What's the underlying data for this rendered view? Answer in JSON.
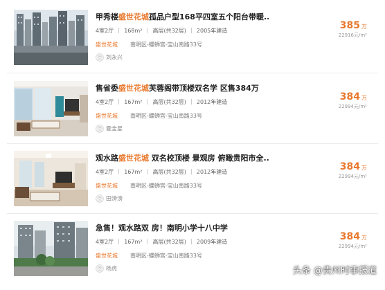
{
  "listings": [
    {
      "title_prefix": "甲秀楼",
      "title_highlight": "盛世花城",
      "title_suffix": "孤品户型168平四室五个阳台带暖...",
      "layout": "4室2厅",
      "area": "168m²",
      "floor": "高层(共32层)",
      "year": "2005年建造",
      "community": "盛世花城",
      "location": "南明区-螺蛳宫-宝山南路33号",
      "agent": "刘永兴",
      "price": "385",
      "price_unit": "万",
      "unit_price": "22916元/m²"
    },
    {
      "title_prefix": "售省委",
      "title_highlight": "盛世花城",
      "title_suffix": "芙蓉阁带顶楼双名学 区售384万",
      "layout": "4室2厅",
      "area": "167m²",
      "floor": "高层(共32层)",
      "year": "2012年建造",
      "community": "盛世花城",
      "location": "南明区-螺蛳宫-宝山南路33号",
      "agent": "霍金星",
      "price": "384",
      "price_unit": "万",
      "unit_price": "22994元/m²"
    },
    {
      "title_prefix": "观水路",
      "title_highlight": "盛世花城",
      "title_suffix": " 双名校顶楼 景观房 俯瞰贵阳市全...",
      "layout": "4室2厅",
      "area": "167m²",
      "floor": "高层(共32层)",
      "year": "2012年建造",
      "community": "盛世花城",
      "location": "南明区-螺蛳宫-宝山南路33号",
      "agent": "田滂滂",
      "price": "384",
      "price_unit": "万",
      "unit_price": "22994元/m²"
    },
    {
      "title_prefix": "急售！观水路双 房！南明小学十八中学",
      "title_highlight": "",
      "title_suffix": "",
      "layout": "4室2厅",
      "area": "167m²",
      "floor": "高层(共32层)",
      "year": "2009年建造",
      "community": "盛世花城",
      "location": "南明区-螺蛳宫-宝山南路33号",
      "agent": "杨虎",
      "price": "384",
      "price_unit": "万",
      "unit_price": "22994元/m²"
    }
  ],
  "watermark": "头条 @贵州时事报道",
  "colors": {
    "accent": "#e8782d",
    "title": "#222222",
    "muted": "#999999"
  }
}
